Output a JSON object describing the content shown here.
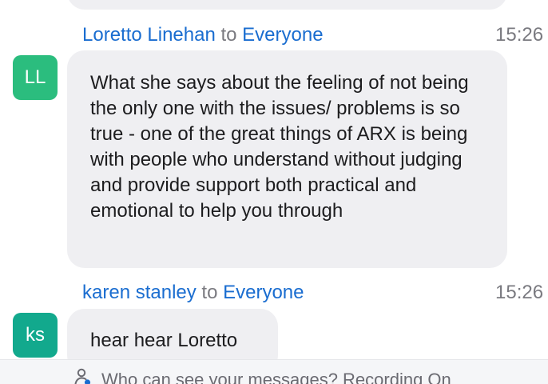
{
  "messages": [
    {
      "sender": "Loretto Linehan",
      "to_label": "to",
      "recipient": "Everyone",
      "time": "15:26",
      "avatar_initials": "LL",
      "avatar_color": "#2bbd7e",
      "text": "What she says about the feeling of not being the only one with the issues/ problems is so true - one of the great things of ARX is being with people who understand without judging and provide support both practical and emotional to help you through"
    },
    {
      "sender": "karen stanley",
      "to_label": "to",
      "recipient": "Everyone",
      "time": "15:26",
      "avatar_initials": "ks",
      "avatar_color": "#12a98d",
      "text": "hear hear Loretto"
    }
  ],
  "footer": {
    "notice": "Who can see your messages? Recording On",
    "icon": "person-icon"
  },
  "colors": {
    "link": "#1a6dd0",
    "muted": "#7a7a80",
    "bubble": "#efeff2"
  }
}
